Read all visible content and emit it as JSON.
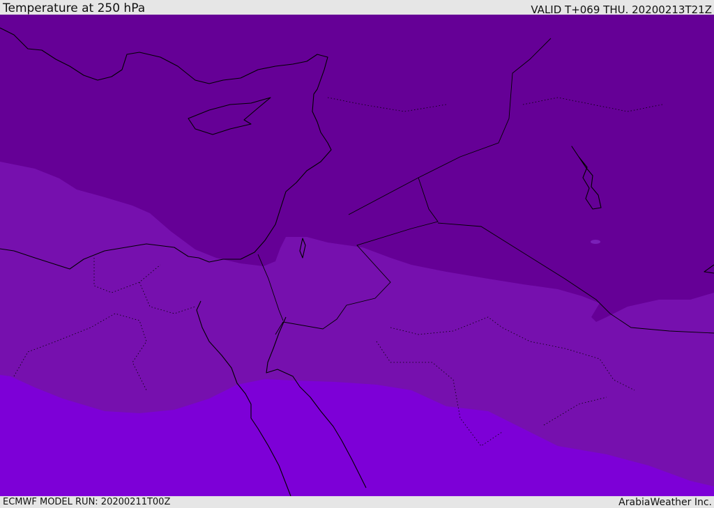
{
  "header": {
    "title": "Temperature at 250 hPa",
    "valid_time": "VALID T+069 THU. 20200213T21Z"
  },
  "footer": {
    "model_run": "ECMWF MODEL RUN: 20200211T00Z",
    "credit": "ArabiaWeather Inc."
  },
  "colors": {
    "band_coldest": "#650096",
    "band_mid": "#7610ae",
    "band_warmest": "#7d00d7",
    "border_line": "#000000"
  }
}
